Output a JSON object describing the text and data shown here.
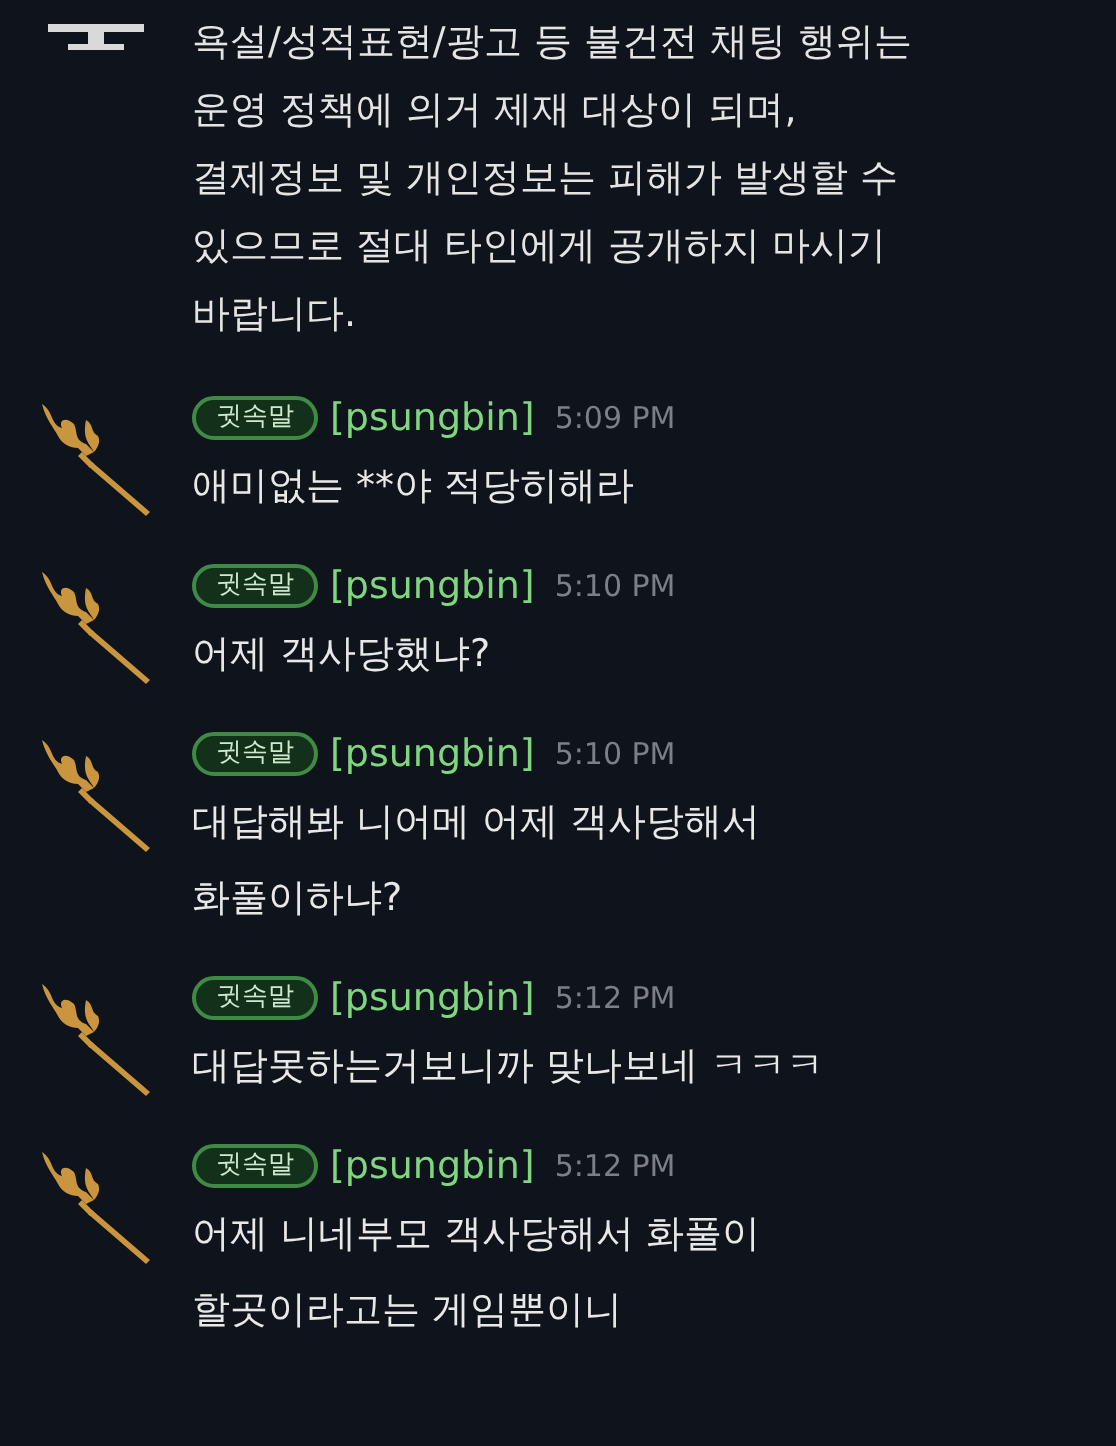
{
  "notice": {
    "text": "욕설/성적표현/광고 등 불건전 채팅 행위는\n운영 정책에 의거 제재 대상이 되며,\n결제정보 및 개인정보는 피해가 발생할 수\n있으므로 절대 타인에게 공개하지 마시기\n바랍니다."
  },
  "messages": [
    {
      "badge": "귓속말",
      "sender": "[psungbin]",
      "time": "5:09 PM",
      "text": "애미없는 **야 적당히해라"
    },
    {
      "badge": "귓속말",
      "sender": "[psungbin]",
      "time": "5:10 PM",
      "text": "어제 객사당했냐?"
    },
    {
      "badge": "귓속말",
      "sender": "[psungbin]",
      "time": "5:10 PM",
      "text": "대답해봐 니어메 어제 객사당해서\n화풀이하냐?"
    },
    {
      "badge": "귓속말",
      "sender": "[psungbin]",
      "time": "5:12 PM",
      "text": "대답못하는거보니까 맞나보네 ㅋㅋㅋ"
    },
    {
      "badge": "귓속말",
      "sender": "[psungbin]",
      "time": "5:12 PM",
      "text": "어제 니네부모 객사당해서 화풀이\n할곳이라고는 게임뿐이니"
    }
  ]
}
